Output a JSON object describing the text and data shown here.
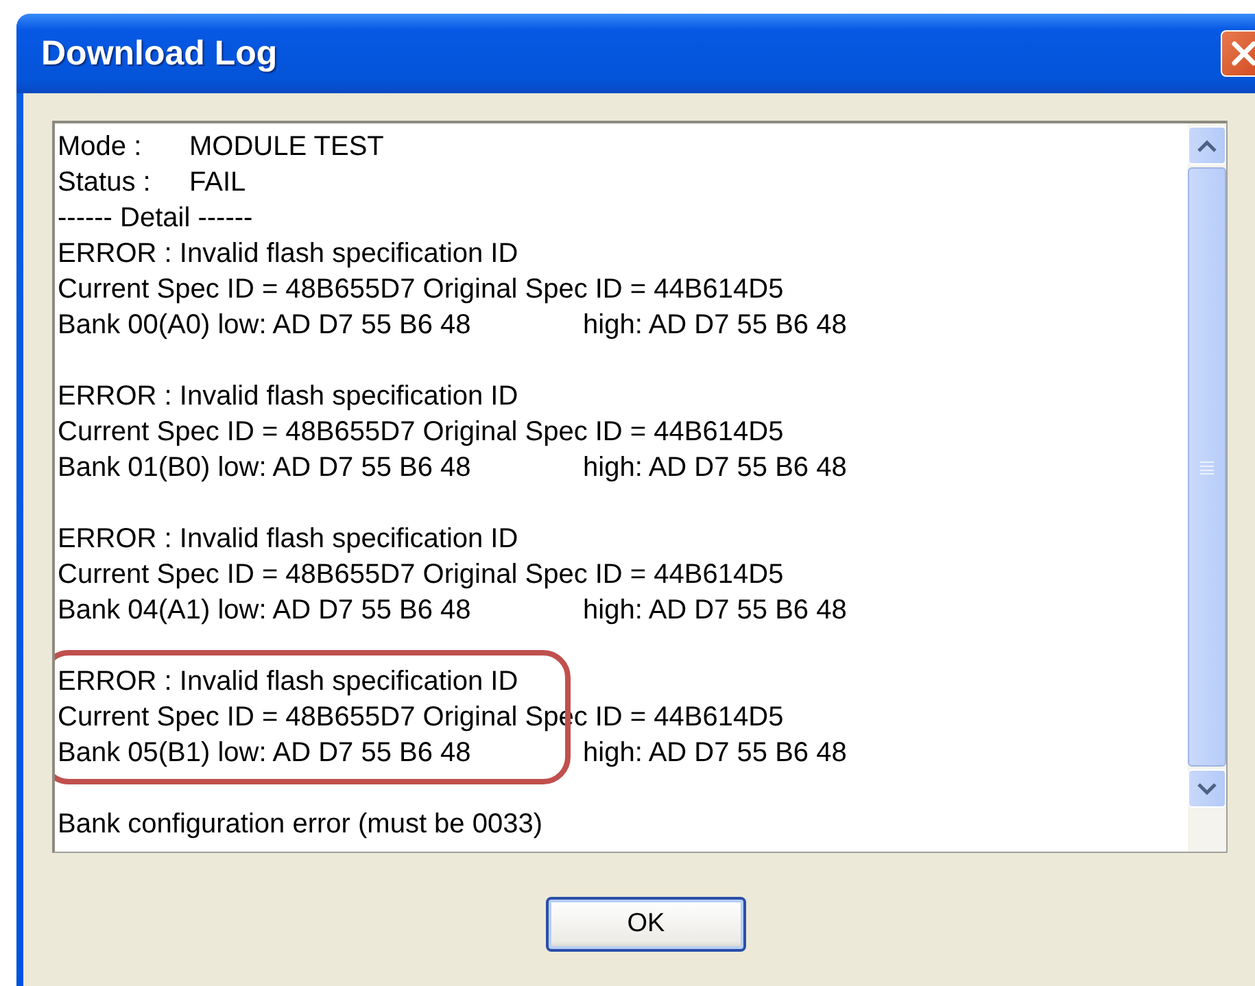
{
  "window": {
    "title": "Download Log"
  },
  "log": {
    "header": [
      {
        "label": "Mode :",
        "value": "MODULE TEST"
      },
      {
        "label": "Status :",
        "value": "FAIL"
      }
    ],
    "detail_heading": "------ Detail ------",
    "blocks": [
      {
        "highlighted": false,
        "error": "ERROR : Invalid flash specification ID",
        "spec": "Current Spec ID = 48B655D7 Original Spec ID = 44B614D5",
        "low": "Bank 00(A0) low: AD D7 55 B6 48",
        "high": "high: AD D7 55 B6 48"
      },
      {
        "highlighted": false,
        "error": "ERROR : Invalid flash specification ID",
        "spec": "Current Spec ID = 48B655D7 Original Spec ID = 44B614D5",
        "low": "Bank 01(B0) low: AD D7 55 B6 48",
        "high": "high: AD D7 55 B6 48"
      },
      {
        "highlighted": false,
        "error": "ERROR : Invalid flash specification ID",
        "spec": "Current Spec ID = 48B655D7 Original Spec ID = 44B614D5",
        "low": "Bank 04(A1) low: AD D7 55 B6 48",
        "high": "high: AD D7 55 B6 48"
      },
      {
        "highlighted": true,
        "error": "ERROR : Invalid flash specification ID",
        "spec": "Current Spec ID = 48B655D7 Original Spec ID = 44B614D5",
        "low": "Bank 05(B1) low: AD D7 55 B6 48",
        "high": "high: AD D7 55 B6 48"
      }
    ],
    "footer": "Bank configuration error (must be 0033)"
  },
  "buttons": [
    "OK"
  ]
}
